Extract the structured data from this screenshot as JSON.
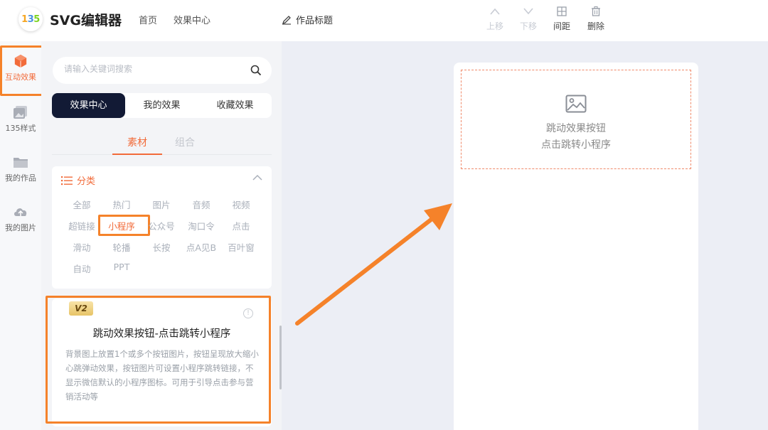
{
  "header": {
    "app_title": "SVG编辑器",
    "nav": [
      "首页",
      "效果中心"
    ],
    "doc_title": "作品标题",
    "tools": [
      {
        "label": "上移",
        "icon": "chevron-up-icon",
        "enabled": false
      },
      {
        "label": "下移",
        "icon": "chevron-down-icon",
        "enabled": false
      },
      {
        "label": "间距",
        "icon": "grid-plus-icon",
        "enabled": true
      },
      {
        "label": "删除",
        "icon": "trash-icon",
        "enabled": true
      }
    ]
  },
  "rail": {
    "items": [
      {
        "label": "互动效果",
        "icon": "cube-icon",
        "active": true
      },
      {
        "label": "135样式",
        "icon": "style-card-icon",
        "active": false
      },
      {
        "label": "我的作品",
        "icon": "folder-icon",
        "active": false
      },
      {
        "label": "我的图片",
        "icon": "cloud-upload-icon",
        "active": false
      }
    ]
  },
  "panel": {
    "search": {
      "placeholder": "请输入关键词搜索",
      "value": ""
    },
    "tabs": [
      {
        "label": "效果中心",
        "active": true
      },
      {
        "label": "我的效果",
        "active": false
      },
      {
        "label": "收藏效果",
        "active": false
      }
    ],
    "subtabs": [
      {
        "label": "素材",
        "active": true
      },
      {
        "label": "组合",
        "active": false
      }
    ],
    "category": {
      "title": "分类",
      "items": [
        "全部",
        "热门",
        "图片",
        "音频",
        "视频",
        "超链接",
        "小程序",
        "公众号",
        "淘口令",
        "点击",
        "滑动",
        "轮播",
        "长按",
        "点A见B",
        "百叶窗",
        "自动",
        "PPT"
      ],
      "selected": "小程序"
    },
    "result": {
      "badge": "V2",
      "title": "跳动效果按钮-点击跳转小程序",
      "description": "背景图上放置1个或多个按钮图片，按钮呈现放大缩小心跳弹动效果，按钮图片可设置小程序跳转链接，不显示微信默认的小程序图标。可用于引导点击参与营销活动等"
    }
  },
  "canvas": {
    "placeholder_lines": [
      "跳动效果按钮",
      "点击跳转小程序"
    ]
  },
  "colors": {
    "accent": "#f26b3a",
    "highlight": "#f5822a",
    "tab_active_bg": "#121a35"
  }
}
